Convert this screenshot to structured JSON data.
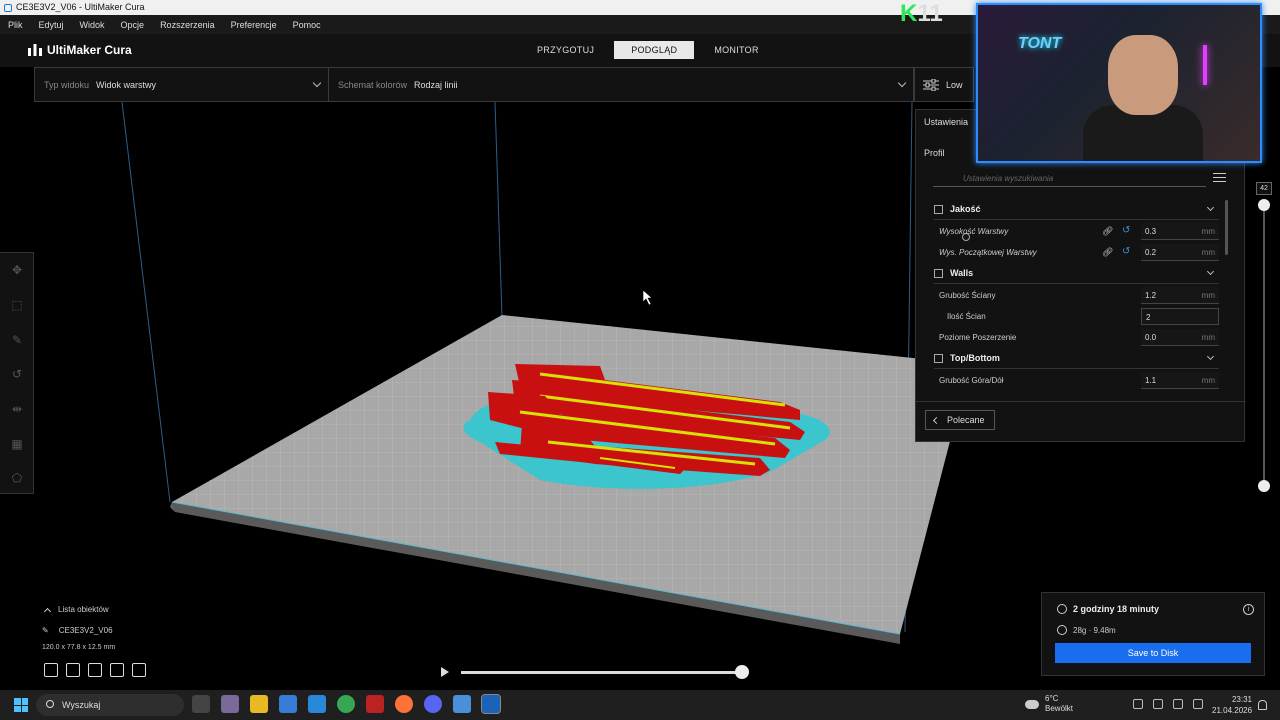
{
  "window": {
    "title": "CE3E3V2_V06 - UltiMaker Cura"
  },
  "menu": [
    "Plik",
    "Edytuj",
    "Widok",
    "Opcje",
    "Rozszerzenia",
    "Preferencje",
    "Pomoc"
  ],
  "header": {
    "brand": "UltiMaker Cura",
    "stages": [
      {
        "label": "PRZYGOTUJ",
        "active": false
      },
      {
        "label": "PODGLĄD",
        "active": true
      },
      {
        "label": "MONITOR",
        "active": false
      }
    ]
  },
  "viewbar": {
    "view_type_label": "Typ widoku",
    "view_type_value": "Widok warstwy",
    "color_scheme_label": "Schemat kolorów",
    "color_scheme_value": "Rodzaj linii",
    "settings_button": "Low"
  },
  "panel": {
    "title": "Ustawienia",
    "profile_label": "Profil",
    "search_placeholder": "Ustawienia wyszukiwania",
    "categories": {
      "quality": "Jakość",
      "walls": "Walls",
      "topbottom": "Top/Bottom"
    },
    "settings": {
      "layer_height": {
        "label": "Wysokość Warstwy",
        "value": "0.3",
        "unit": "mm"
      },
      "initial_layer_height": {
        "label": "Wys. Początkowej Warstwy",
        "value": "0.2",
        "unit": "mm"
      },
      "wall_thickness": {
        "label": "Grubość Ściany",
        "value": "1.2",
        "unit": "mm"
      },
      "wall_count": {
        "label": "Ilość Ścian",
        "value": "2"
      },
      "horizontal_expansion": {
        "label": "Poziome Poszerzenie",
        "value": "0.0",
        "unit": "mm"
      },
      "topbottom_thickness": {
        "label": "Grubość Góra/Dół",
        "value": "1.1",
        "unit": "mm"
      }
    },
    "recommended_button": "Polecane"
  },
  "layer_slider": {
    "current_layer": "42"
  },
  "object_list": {
    "header": "Lista obiektów",
    "object_name": "CE3E3V2_V06",
    "dimensions": "120.0 x 77.8 x 12.5 mm"
  },
  "print_info": {
    "time": "2 godziny 18 minuty",
    "material": "28g · 9.48m",
    "save_button": "Save to Disk"
  },
  "stream_overlay": {
    "badge_letter": "K",
    "badge_number": "11",
    "webcam_text": "TONT"
  },
  "taskbar": {
    "search": "Wyszukaj",
    "weather_temp": "6°C",
    "weather_desc": "Bewölkt",
    "time": "23:31",
    "date": "21.04.2026"
  },
  "colors": {
    "accent": "#196ef0",
    "part_red": "#c81010",
    "part_yellow": "#d8e00a",
    "support_cyan": "#30c8d0",
    "plate": "#a9a9a9"
  }
}
